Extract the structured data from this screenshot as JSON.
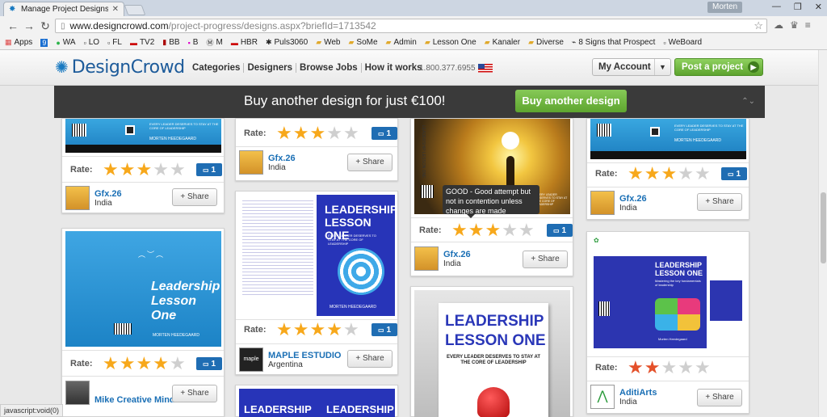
{
  "browser": {
    "tab_title": "Manage Project Designs |",
    "profile": "Morten",
    "url_host": "www.designcrowd.com",
    "url_path": "/project-progress/designs.aspx?briefId=1713542",
    "bookmarks": [
      "Apps",
      "9",
      "WA",
      "LO",
      "FL",
      "TV2",
      "BB",
      "B",
      "M",
      "HBR",
      "Puls3060",
      "Web",
      "SoMe",
      "Admin",
      "Lesson One",
      "Kanaler",
      "Diverse",
      "8 Signs that Prospect",
      "WeBoard"
    ],
    "status_text": "javascript:void(0)"
  },
  "site": {
    "logo": "DesignCrowd",
    "nav": [
      "Categories",
      "Designers",
      "Browse Jobs",
      "How it works"
    ],
    "phone": "1.800.377.6955",
    "my_account": "My Account",
    "post_project": "Post a project"
  },
  "banner": {
    "text": "Buy another design for just €100!",
    "button": "Buy another design"
  },
  "common": {
    "rate_label": "Rate:",
    "share_label": "+ Share"
  },
  "tooltip": "GOOD - Good attempt but not in contention unless changes are made",
  "cards": [
    {
      "id": "c1",
      "stars": 3,
      "comments": "1",
      "designer": "Gfx.26",
      "country": "India"
    },
    {
      "id": "c2",
      "stars": 3,
      "comments": "1",
      "designer": "Gfx.26",
      "country": "India"
    },
    {
      "id": "c3",
      "stars": 3,
      "comments": "1",
      "designer": "Gfx.26",
      "country": "India"
    },
    {
      "id": "c4",
      "stars": 3,
      "comments": "1",
      "designer": "Gfx.26",
      "country": "India"
    },
    {
      "id": "c5",
      "stars": 4,
      "comments": "1",
      "designer": "Mike Creative Mind",
      "country": ""
    },
    {
      "id": "c6",
      "stars": 4,
      "comments": "1",
      "designer": "MAPLE ESTUDIO",
      "country": "Argentina"
    },
    {
      "id": "c7",
      "stars": 2,
      "comments": "",
      "designer": "AditiArts",
      "country": "India"
    }
  ],
  "thumb_text": {
    "every_leader": "EVERY LEADER DESERVES TO STAY AT THE CORE OF LEADERSHIP",
    "author": "MORTEN HEEDEGAARD",
    "leadership": "LEADERSHIP",
    "lesson_one": "LESSON ONE",
    "leadership_lc": "Leadership",
    "lesson_one_lc": "Lesson One",
    "subtitle_small": "Mastering the key fundamentals of leadership",
    "author_small": "Morten Heedegaard",
    "maple_logo": "maple",
    "thumb3_vertical": "LEADERSHIP LESSON ONE",
    "thumb3_right": "EVERY LEADER DESERVES TO STAY AT THE CORE OF LEADERSHIP"
  },
  "colors": {
    "brand_blue": "#1d5b9a",
    "accent_green": "#6bb33a",
    "star": "#f7a81b",
    "badge": "#1f6db3"
  }
}
